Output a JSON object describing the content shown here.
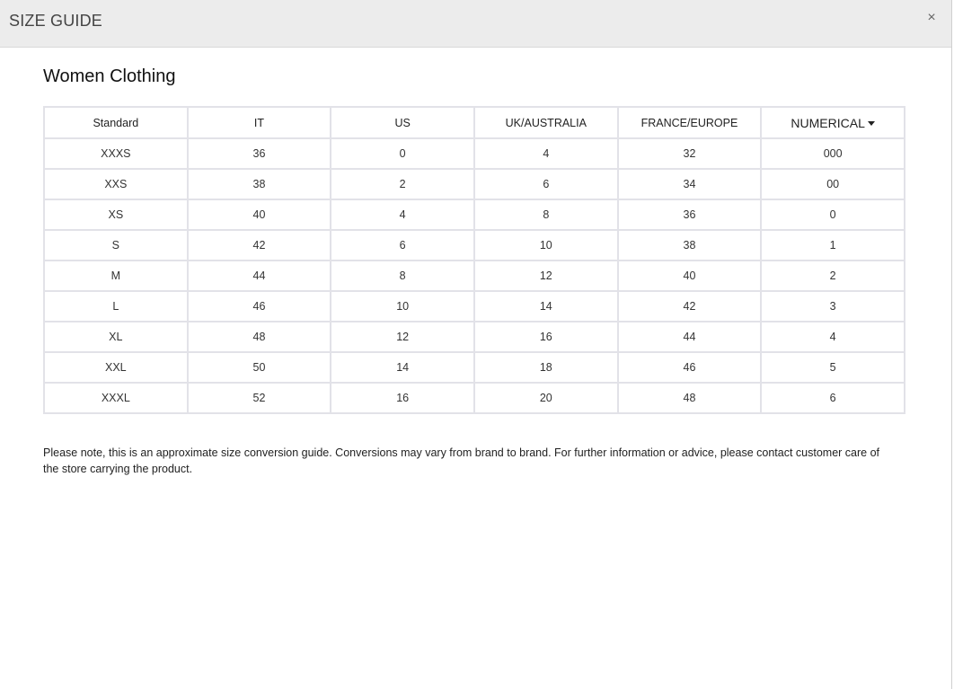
{
  "modal": {
    "title": "SIZE GUIDE",
    "close_label": "×"
  },
  "section": {
    "title": "Women Clothing"
  },
  "table": {
    "headers": [
      "Standard",
      "IT",
      "US",
      "UK/AUSTRALIA",
      "FRANCE/EUROPE",
      "NUMERICAL"
    ],
    "rows": [
      [
        "XXXS",
        "36",
        "0",
        "4",
        "32",
        "000"
      ],
      [
        "XXS",
        "38",
        "2",
        "6",
        "34",
        "00"
      ],
      [
        "XS",
        "40",
        "4",
        "8",
        "36",
        "0"
      ],
      [
        "S",
        "42",
        "6",
        "10",
        "38",
        "1"
      ],
      [
        "M",
        "44",
        "8",
        "12",
        "40",
        "2"
      ],
      [
        "L",
        "46",
        "10",
        "14",
        "42",
        "3"
      ],
      [
        "XL",
        "48",
        "12",
        "16",
        "44",
        "4"
      ],
      [
        "XXL",
        "50",
        "14",
        "18",
        "46",
        "5"
      ],
      [
        "XXXL",
        "52",
        "16",
        "20",
        "48",
        "6"
      ]
    ]
  },
  "note": "Please note, this is an approximate size conversion guide. Conversions may vary from brand to brand. For further information or advice, please contact customer care of the store carrying the product."
}
